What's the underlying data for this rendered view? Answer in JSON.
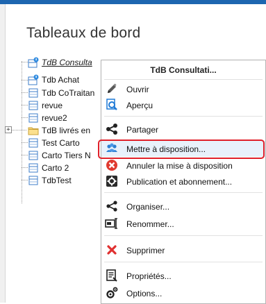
{
  "page": {
    "title": "Tableaux de bord"
  },
  "tree": {
    "items": [
      {
        "label": "TdB Consulta",
        "icon": "shared-dashboard-icon"
      },
      {
        "label": "Tdb Achat",
        "icon": "shared-dashboard-icon"
      },
      {
        "label": "Tdb CoTraitan",
        "icon": "dashboard-icon"
      },
      {
        "label": "revue",
        "icon": "dashboard-icon"
      },
      {
        "label": "revue2",
        "icon": "dashboard-icon"
      },
      {
        "label": "TdB livrés en",
        "icon": "folder-icon"
      },
      {
        "label": "Test Carto",
        "icon": "dashboard-icon"
      },
      {
        "label": "Carto Tiers N",
        "icon": "dashboard-icon"
      },
      {
        "label": "Carto 2",
        "icon": "dashboard-icon"
      },
      {
        "label": "TdbTest",
        "icon": "dashboard-icon"
      }
    ],
    "expander": "+"
  },
  "menu": {
    "header": "TdB Consultati...",
    "items": [
      {
        "label": "Ouvrir",
        "icon": "pencil-icon"
      },
      {
        "label": "Aperçu",
        "icon": "preview-icon"
      },
      {
        "label": "Partager",
        "icon": "share-icon"
      },
      {
        "label": "Mettre à disposition...",
        "icon": "users-icon"
      },
      {
        "label": "Annuler la mise à disposition",
        "icon": "cancel-icon"
      },
      {
        "label": "Publication et abonnement...",
        "icon": "gear-icon"
      },
      {
        "label": "Organiser...",
        "icon": "organize-icon"
      },
      {
        "label": "Renommer...",
        "icon": "rename-icon"
      },
      {
        "label": "Supprimer",
        "icon": "delete-icon"
      },
      {
        "label": "Propriétés...",
        "icon": "properties-icon"
      },
      {
        "label": "Options...",
        "icon": "options-icon"
      }
    ],
    "highlighted": "Mettre à disposition..."
  },
  "colors": {
    "accent": "#1d66b0",
    "highlight_ring": "#e0202a",
    "delete": "#e03030"
  }
}
